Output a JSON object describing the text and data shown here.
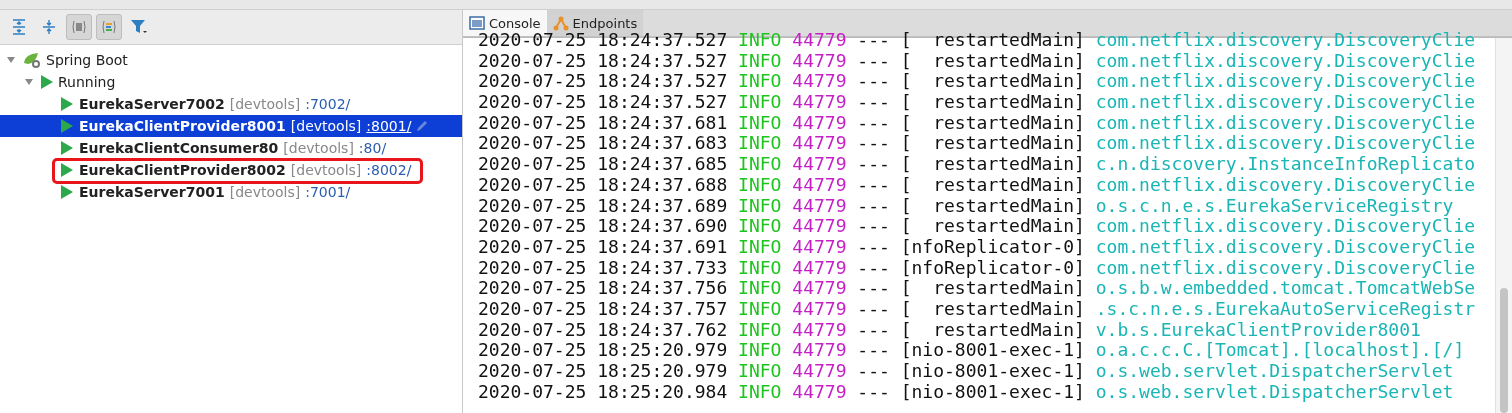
{
  "toolbar": {
    "buttons": [
      {
        "kind": "expand",
        "pressed": false
      },
      {
        "kind": "collapse",
        "pressed": false
      },
      {
        "kind": "group",
        "pressed": true
      },
      {
        "kind": "layout",
        "pressed": true
      },
      {
        "kind": "filter",
        "pressed": false
      }
    ]
  },
  "tree": {
    "label": "Spring Boot",
    "expanded": true,
    "children": [
      {
        "label": "Running",
        "expanded": true,
        "children": [
          {
            "name": "EurekaServer7002",
            "tag": "[devtools]",
            "port": ":7002/",
            "selected": false,
            "highlighted": false
          },
          {
            "name": "EurekaClientProvider8001",
            "tag": "[devtools]",
            "port": ":8001/",
            "selected": true,
            "highlighted": false
          },
          {
            "name": "EurekaClientConsumer80",
            "tag": "[devtools]",
            "port": ":80/",
            "selected": false,
            "highlighted": false
          },
          {
            "name": "EurekaClientProvider8002",
            "tag": "[devtools]",
            "port": ":8002/",
            "selected": false,
            "highlighted": true
          },
          {
            "name": "EurekaServer7001",
            "tag": "[devtools]",
            "port": ":7001/",
            "selected": false,
            "highlighted": false
          }
        ]
      }
    ]
  },
  "tabs": [
    {
      "label": "Console",
      "kind": "console",
      "selected": true
    },
    {
      "label": "Endpoints",
      "kind": "endpoints",
      "selected": false
    }
  ],
  "console": [
    {
      "time": "2020-07-25 18:24:37.527",
      "level": "INFO",
      "pid": "44779",
      "sep": "---",
      "thread": "[  restartedMain]",
      "logger": "com.netflix.discovery.DiscoveryClie"
    },
    {
      "time": "2020-07-25 18:24:37.527",
      "level": "INFO",
      "pid": "44779",
      "sep": "---",
      "thread": "[  restartedMain]",
      "logger": "com.netflix.discovery.DiscoveryClie"
    },
    {
      "time": "2020-07-25 18:24:37.527",
      "level": "INFO",
      "pid": "44779",
      "sep": "---",
      "thread": "[  restartedMain]",
      "logger": "com.netflix.discovery.DiscoveryClie"
    },
    {
      "time": "2020-07-25 18:24:37.527",
      "level": "INFO",
      "pid": "44779",
      "sep": "---",
      "thread": "[  restartedMain]",
      "logger": "com.netflix.discovery.DiscoveryClie"
    },
    {
      "time": "2020-07-25 18:24:37.681",
      "level": "INFO",
      "pid": "44779",
      "sep": "---",
      "thread": "[  restartedMain]",
      "logger": "com.netflix.discovery.DiscoveryClie"
    },
    {
      "time": "2020-07-25 18:24:37.683",
      "level": "INFO",
      "pid": "44779",
      "sep": "---",
      "thread": "[  restartedMain]",
      "logger": "com.netflix.discovery.DiscoveryClie"
    },
    {
      "time": "2020-07-25 18:24:37.685",
      "level": "INFO",
      "pid": "44779",
      "sep": "---",
      "thread": "[  restartedMain]",
      "logger": "c.n.discovery.InstanceInfoReplicato"
    },
    {
      "time": "2020-07-25 18:24:37.688",
      "level": "INFO",
      "pid": "44779",
      "sep": "---",
      "thread": "[  restartedMain]",
      "logger": "com.netflix.discovery.DiscoveryClie"
    },
    {
      "time": "2020-07-25 18:24:37.689",
      "level": "INFO",
      "pid": "44779",
      "sep": "---",
      "thread": "[  restartedMain]",
      "logger": "o.s.c.n.e.s.EurekaServiceRegistry"
    },
    {
      "time": "2020-07-25 18:24:37.690",
      "level": "INFO",
      "pid": "44779",
      "sep": "---",
      "thread": "[  restartedMain]",
      "logger": "com.netflix.discovery.DiscoveryClie"
    },
    {
      "time": "2020-07-25 18:24:37.691",
      "level": "INFO",
      "pid": "44779",
      "sep": "---",
      "thread": "[nfoReplicator-0]",
      "logger": "com.netflix.discovery.DiscoveryClie"
    },
    {
      "time": "2020-07-25 18:24:37.733",
      "level": "INFO",
      "pid": "44779",
      "sep": "---",
      "thread": "[nfoReplicator-0]",
      "logger": "com.netflix.discovery.DiscoveryClie"
    },
    {
      "time": "2020-07-25 18:24:37.756",
      "level": "INFO",
      "pid": "44779",
      "sep": "---",
      "thread": "[  restartedMain]",
      "logger": "o.s.b.w.embedded.tomcat.TomcatWebSe"
    },
    {
      "time": "2020-07-25 18:24:37.757",
      "level": "INFO",
      "pid": "44779",
      "sep": "---",
      "thread": "[  restartedMain]",
      "logger": ".s.c.n.e.s.EurekaAutoServiceRegistr"
    },
    {
      "time": "2020-07-25 18:24:37.762",
      "level": "INFO",
      "pid": "44779",
      "sep": "---",
      "thread": "[  restartedMain]",
      "logger": "v.b.s.EurekaClientProvider8001"
    },
    {
      "time": "2020-07-25 18:25:20.979",
      "level": "INFO",
      "pid": "44779",
      "sep": "---",
      "thread": "[nio-8001-exec-1]",
      "logger": "o.a.c.c.C.[Tomcat].[localhost].[/]"
    },
    {
      "time": "2020-07-25 18:25:20.979",
      "level": "INFO",
      "pid": "44779",
      "sep": "---",
      "thread": "[nio-8001-exec-1]",
      "logger": "o.s.web.servlet.DispatcherServlet"
    },
    {
      "time": "2020-07-25 18:25:20.984",
      "level": "INFO",
      "pid": "44779",
      "sep": "---",
      "thread": "[nio-8001-exec-1]",
      "logger": "o.s.web.servlet.DispatcherServlet"
    }
  ]
}
